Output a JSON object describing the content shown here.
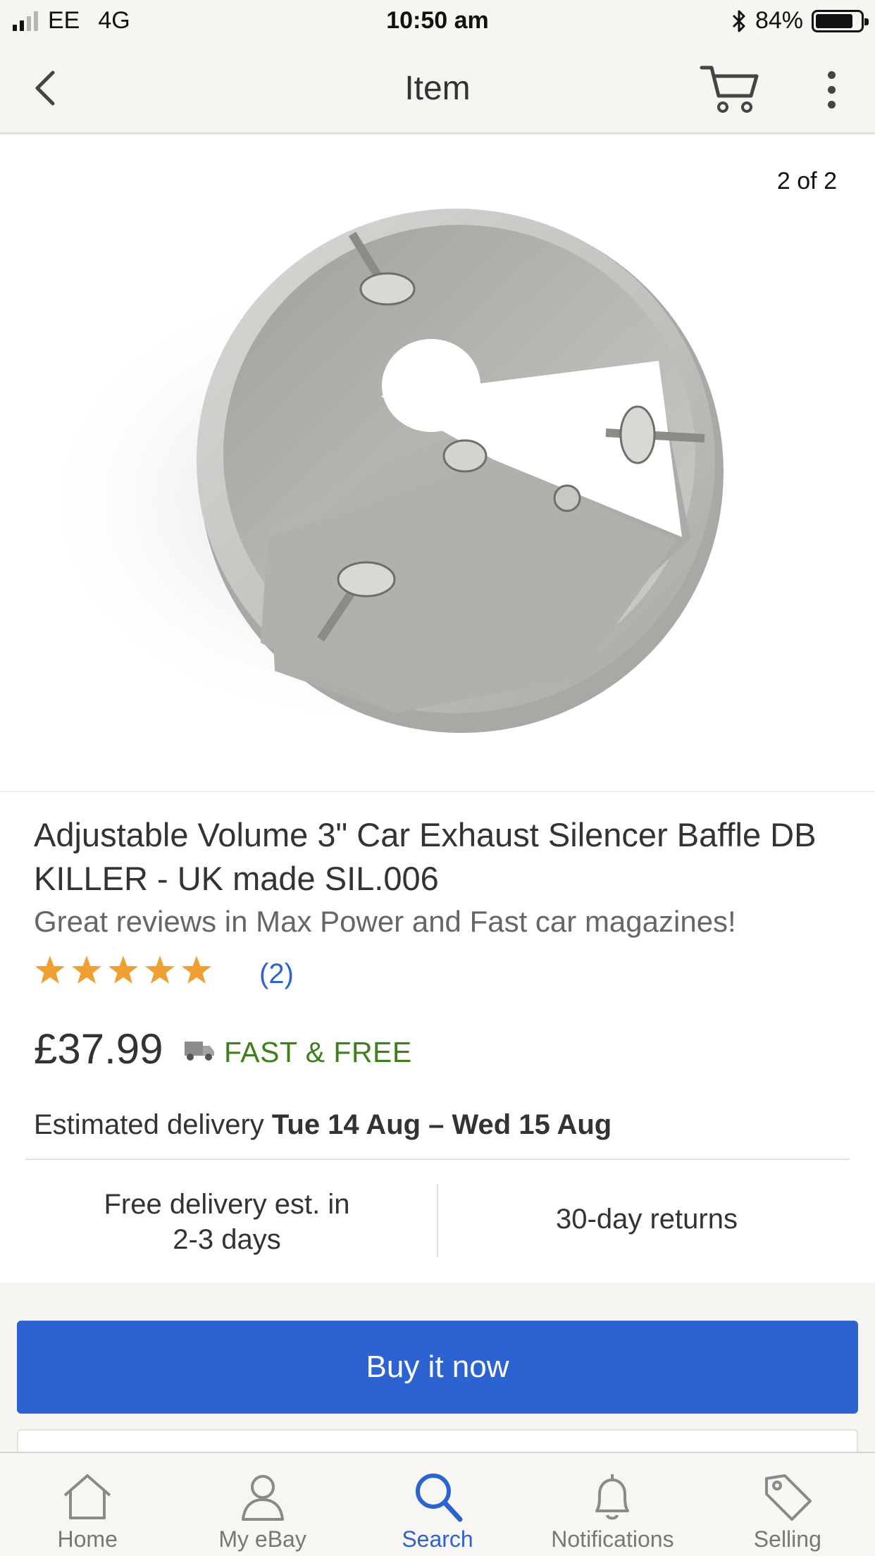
{
  "status_bar": {
    "carrier": "EE",
    "network": "4G",
    "time": "10:50 am",
    "battery_percent": "84%",
    "battery_level": 0.84,
    "signal_bars_filled": 2,
    "signal_bars_total": 4
  },
  "nav": {
    "title": "Item"
  },
  "gallery": {
    "counter": "2 of 2"
  },
  "item": {
    "title": "Adjustable Volume 3\" Car Exhaust Silencer Baffle DB KILLER - UK made SIL.006",
    "subtitle": "Great reviews in Max Power and Fast car magazines!",
    "rating": 5,
    "rating_max": 5,
    "review_count": "(2)",
    "price": "£37.99",
    "shipping": "FAST & FREE",
    "delivery_label": "Estimated delivery",
    "delivery_dates": "Tue 14 Aug – Wed 15 Aug",
    "feature_left_line1": "Free delivery est. in",
    "feature_left_line2": "2-3 days",
    "feature_right": "30-day returns"
  },
  "actions": {
    "buy_now": "Buy it now"
  },
  "tabbar": {
    "items": [
      {
        "label": "Home",
        "icon": "home-icon"
      },
      {
        "label": "My eBay",
        "icon": "user-icon"
      },
      {
        "label": "Search",
        "icon": "search-icon",
        "active": true
      },
      {
        "label": "Notifications",
        "icon": "bell-icon"
      },
      {
        "label": "Selling",
        "icon": "tag-icon"
      }
    ]
  },
  "colors": {
    "accent": "#2d63d0",
    "shipping_green": "#3f7f1e",
    "star": "#f0a032",
    "background": "#f6f5f1"
  }
}
